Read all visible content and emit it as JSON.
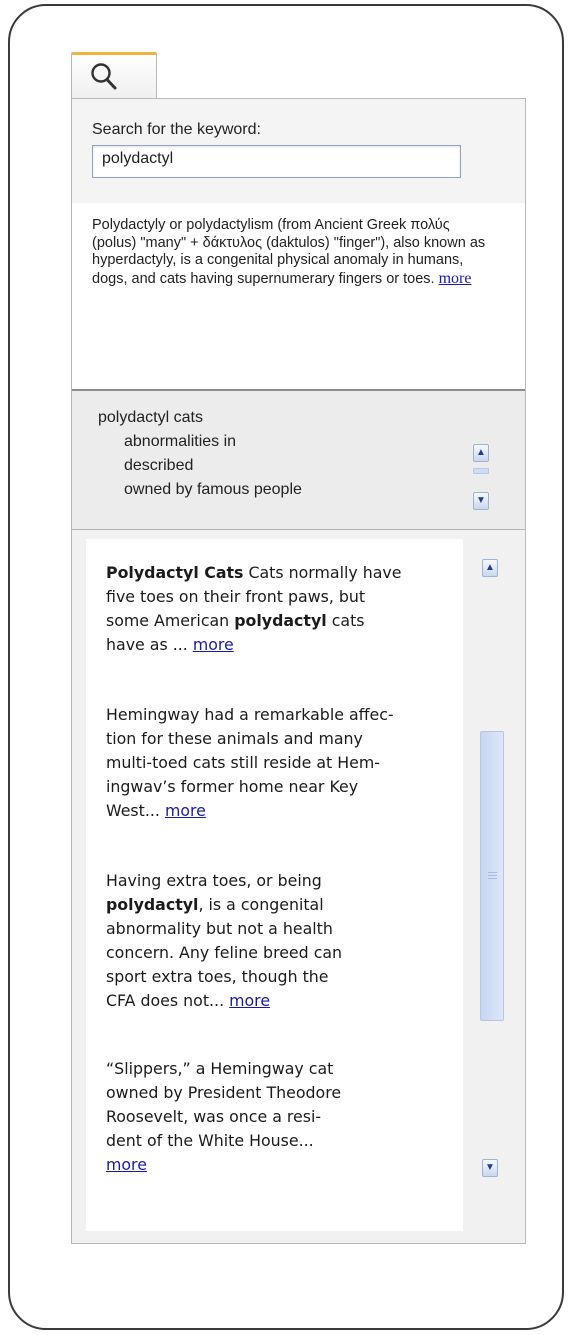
{
  "search": {
    "label": "Search for the keyword:",
    "value": "polydactyl"
  },
  "definition": {
    "text": "Polydactyly or polydactylism (from Ancient Greek πολύς (polus) \"many\" + δάκτυλος (daktulos) \"finger\"), also known as hyperdactyly, is a congenital physical anomaly in humans, dogs, and cats having supernumerary fingers or toes.",
    "more": "more"
  },
  "topics": {
    "title": "polydactyl cats",
    "items": [
      "abnormalities in",
      "described",
      "owned by famous people"
    ]
  },
  "results": [
    {
      "bold": "Polydactyl Cats",
      "pre": " Cats normally have\nfive toes on their front paws, but\nsome American ",
      "bold2": "polydactyl",
      "post": " cats\nhave as ... ",
      "more": "more"
    },
    {
      "bold": "",
      "pre": "Hemingway had a remarkable affec-\ntion for these animals and many\nmulti-toed cats still reside at Hem-\ningwav’s former home near Key\nWest... ",
      "bold2": "",
      "post": "",
      "more": "more"
    },
    {
      "bold": "",
      "pre": "Having extra toes, or being\n",
      "bold2": "polydactyl",
      "post": ", is a congenital\nabnormality but not a health\nconcern. Any feline breed can\nsport extra toes, though the\nCFA does not...  ",
      "more": "more"
    },
    {
      "bold": "",
      "pre": "“Slippers,” a Hemingway cat\nowned by President Theodore\nRoosevelt, was once a resi-\ndent of the White House...\n",
      "bold2": "",
      "post": "",
      "more": "more"
    }
  ],
  "icons": {
    "search": "magnifier-icon",
    "scroll_up": "chevron-up-icon",
    "scroll_down": "chevron-down-icon"
  },
  "colors": {
    "tab_accent": "#f2b53c",
    "link": "#1a1aa6",
    "scrollbar": "#c7d6ef"
  }
}
